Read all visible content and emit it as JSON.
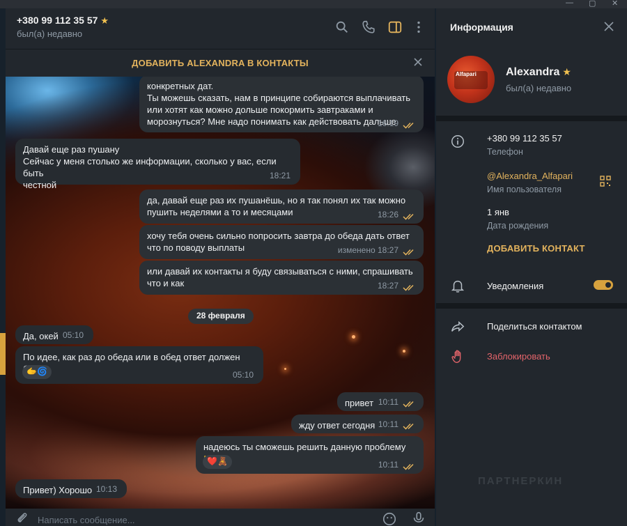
{
  "chat_header": {
    "title": "+380 99 112 35 57",
    "status": "был(а) недавно"
  },
  "add_bar": {
    "label": "ДОБАВИТЬ ALEXANDRA В КОНТАКТЫ"
  },
  "messages": [
    {
      "dir": "out",
      "text": "конкретных дат.\nТы можешь сказать, нам в принципе собираются выплачивать\nили хотят как можно дольше покормить завтраками и\nморознуться? Мне надо понимать как действовать дальше",
      "time": "16:19"
    },
    {
      "dir": "in",
      "text": "Давай еще раз пушану\nСейчас у меня столько же информации, сколько у вас, если быть\nчестной",
      "time": "18:21"
    },
    {
      "dir": "out",
      "text": "да, давай еще раз их пушанёшь, но я так понял их так можно\nпушить неделями а то и месяцами",
      "time": "18:26"
    },
    {
      "dir": "out",
      "text": "хочу тебя очень сильно попросить завтра до обеда дать ответ\nчто по поводу выплаты",
      "time": "изменено 18:27"
    },
    {
      "dir": "out",
      "text": "или давай их контакты я буду связываться с ними, спрашивать\nчто и как",
      "time": "18:27"
    },
    {
      "dir": "in",
      "text": "Да, окей",
      "time": "05:10"
    },
    {
      "dir": "in",
      "text": "По идее, как раз до обеда или в обед ответ должен быть",
      "time": "05:10",
      "reaction": "🫱🌀"
    },
    {
      "dir": "out",
      "text": "привет",
      "time": "10:11"
    },
    {
      "dir": "out",
      "text": "жду ответ сегодня",
      "time": "10:11"
    },
    {
      "dir": "out",
      "text": "надеюсь ты сможешь решить данную проблему 🤝",
      "time": "10:11",
      "reaction": "❤️🧸"
    },
    {
      "dir": "in",
      "text": "Привет) Хорошо",
      "time": "10:13"
    }
  ],
  "date_chip": "28 февраля",
  "composer": {
    "placeholder": "Написать сообщение..."
  },
  "panel": {
    "title": "Информация",
    "name": "Alexandra",
    "status": "был(а) недавно",
    "avatar_text": "Alfapari",
    "phone": "+380 99 112 35 57",
    "phone_label": "Телефон",
    "username": "@Alexandra_Alfapari",
    "username_label": "Имя пользователя",
    "birthday": "1 янв",
    "birthday_label": "Дата рождения",
    "add_contact": "ДОБАВИТЬ КОНТАКТ",
    "notifications": "Уведомления",
    "share": "Поделиться контактом",
    "block": "Заблокировать",
    "watermark": "ПАРТНЕРКИН"
  },
  "colors": {
    "accent": "#e3b35d",
    "toggle": "#d7a23e",
    "danger": "#e3646a"
  }
}
